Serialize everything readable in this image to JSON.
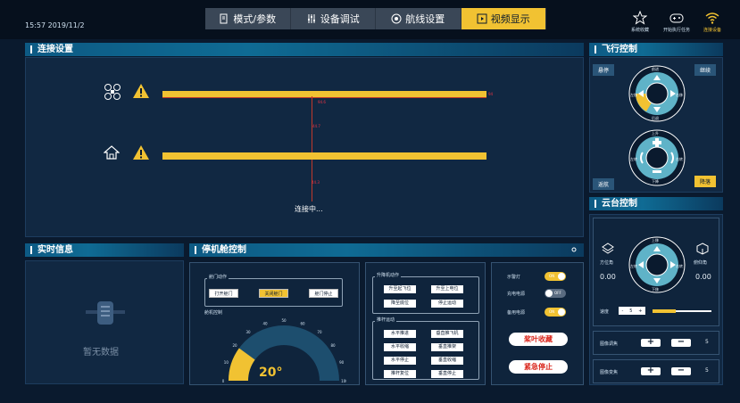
{
  "topbar": {
    "clock": "15:57 2019/11/2",
    "tabs": [
      {
        "label": "模式/参数",
        "active": false
      },
      {
        "label": "设备调试",
        "active": false
      },
      {
        "label": "航线设置",
        "active": false
      },
      {
        "label": "视频显示",
        "active": true
      }
    ],
    "icons": [
      {
        "label": "系统收藏",
        "icon": "star-icon"
      },
      {
        "label": "开始执行任务",
        "icon": "gamepad-icon"
      },
      {
        "label": "连接设备",
        "icon": "wifi-icon"
      }
    ]
  },
  "connection": {
    "title": "连接设置",
    "status": "连接中...",
    "top_bar_value": "94",
    "top_marker": "94.6",
    "mid_marker": "44.7",
    "bottom_marker": "44.3"
  },
  "realtime": {
    "title": "实时信息",
    "empty_text": "暂无数据"
  },
  "hangar": {
    "title": "停机舱控制",
    "door_group": "舱门动作",
    "door_buttons": [
      "打开舱门",
      "关闭舱门",
      "舱门停止"
    ],
    "gauge_label": "舱机控制",
    "gauge_ticks": [
      "0",
      "10",
      "20",
      "30",
      "40",
      "50",
      "60",
      "70",
      "80",
      "90",
      "100"
    ],
    "gauge_value": "20°",
    "gauge_fraction": 0.2,
    "lift_group": "升降机动作",
    "lift_buttons": [
      "升至起飞位",
      "升至上电位",
      "降至底位",
      "停止运动"
    ],
    "pusher_group": "推杆运动",
    "pusher_buttons": [
      "水平推进",
      "垂直推飞机",
      "水平收缩",
      "垂直推架",
      "水平停止",
      "垂直收缩",
      "推杆复位",
      "垂直停止"
    ],
    "toggles": [
      {
        "label": "示警灯",
        "state": "ON"
      },
      {
        "label": "充电电源",
        "state": "OFF"
      },
      {
        "label": "备用电源",
        "state": "ON"
      }
    ],
    "red_buttons": [
      "桨叶收藏",
      "紧急停止"
    ]
  },
  "flight": {
    "title": "飞行控制",
    "hover_button": "悬停",
    "continue_button": "继续",
    "return_button": "返航",
    "land_button": "降落",
    "dial1": {
      "top": "前进",
      "bottom": "后退",
      "left": "左移",
      "right": "右移"
    },
    "dial2": {
      "top": "上升",
      "bottom": "下降",
      "left": "左转",
      "right": "右转"
    }
  },
  "gimbal": {
    "title": "云台控制",
    "azimuth_label": "方位角",
    "azimuth_value": "0.00",
    "pitch_label": "俯仰角",
    "pitch_value": "0.00",
    "dial": {
      "top": "上移",
      "bottom": "下移",
      "left": "左转",
      "right": "右转"
    },
    "speed_label": "速度",
    "speed_value": "5",
    "focus_label": "图像调焦",
    "focus_value": "5",
    "zoom_label": "图像变焦",
    "zoom_value": "5"
  }
}
